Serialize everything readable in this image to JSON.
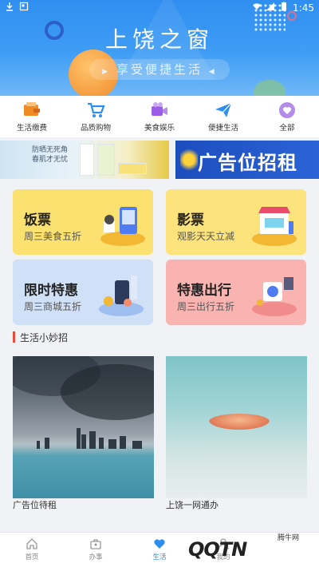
{
  "status_bar": {
    "time": "1:45"
  },
  "banner": {
    "title": "上饶之窗",
    "subtitle": "享受便捷生活"
  },
  "categories": [
    {
      "label": "生活缴费",
      "icon": "wallet-icon",
      "color": "#f08a24"
    },
    {
      "label": "品质购物",
      "icon": "cart-icon",
      "color": "#2e8ef0"
    },
    {
      "label": "美食娱乐",
      "icon": "video-icon",
      "color": "#9b5de5"
    },
    {
      "label": "便捷生活",
      "icon": "paper-plane-icon",
      "color": "#2e8ef0"
    },
    {
      "label": "全部",
      "icon": "heart-icon",
      "color": "#9b5de5"
    }
  ],
  "ads": {
    "left_text_1": "防晒无死角",
    "left_text_2": "春肌才无忧",
    "right_text": "广告位招租"
  },
  "promos": [
    {
      "title": "饭票",
      "subtitle": "周三美食五折"
    },
    {
      "title": "影票",
      "subtitle": "观影天天立减"
    },
    {
      "title": "限时特惠",
      "subtitle": "周三商城五折"
    },
    {
      "title": "特惠出行",
      "subtitle": "周三出行五折"
    }
  ],
  "section": {
    "title": "生活小妙招"
  },
  "tiles": [
    {
      "label": "广告位待租"
    },
    {
      "label": "上饶一网通办"
    }
  ],
  "nav": [
    {
      "label": "首页",
      "icon": "home-icon",
      "active": false
    },
    {
      "label": "办事",
      "icon": "briefcase-icon",
      "active": false
    },
    {
      "label": "生活",
      "icon": "heart-icon",
      "active": true
    },
    {
      "label": "我的",
      "icon": "user-icon",
      "active": false
    }
  ],
  "watermark": {
    "logo": "QQTN",
    "sub": "腾牛网"
  },
  "colors": {
    "primary": "#2e8ef0",
    "accent": "#e84b3c"
  }
}
